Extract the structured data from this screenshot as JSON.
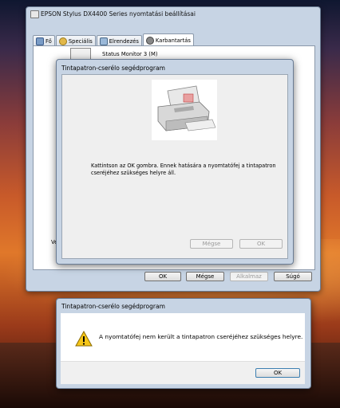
{
  "main_window": {
    "title": "EPSON Stylus DX4400 Series nyomtatási beállításai",
    "tabs": [
      {
        "label": "Fő",
        "active": false
      },
      {
        "label": "Speciális",
        "active": false
      },
      {
        "label": "Elrendezés",
        "active": false
      },
      {
        "label": "Karbantartás",
        "active": true
      }
    ],
    "status_monitor_label": "Status Monitor 3 (M)",
    "version_label": "Ver",
    "buttons": {
      "ok": "OK",
      "cancel": "Mégse",
      "apply": "Alkalmaz",
      "help": "Súgó"
    }
  },
  "wizard": {
    "title": "Tintapatron-cserélo segédprogram",
    "instruction": "Kattintson az OK gombra. Ennek hatására a nyomtatófej a tintapatron cseréjéhez szükséges helyre áll.",
    "buttons": {
      "cancel": "Mégse",
      "ok": "OK"
    }
  },
  "message_box": {
    "title": "Tintapatron-cserélo segédprogram",
    "message": "A nyomtatófej nem került a tintapatron cseréjéhez szükséges helyre.",
    "ok": "OK",
    "icon": "warning-icon"
  }
}
